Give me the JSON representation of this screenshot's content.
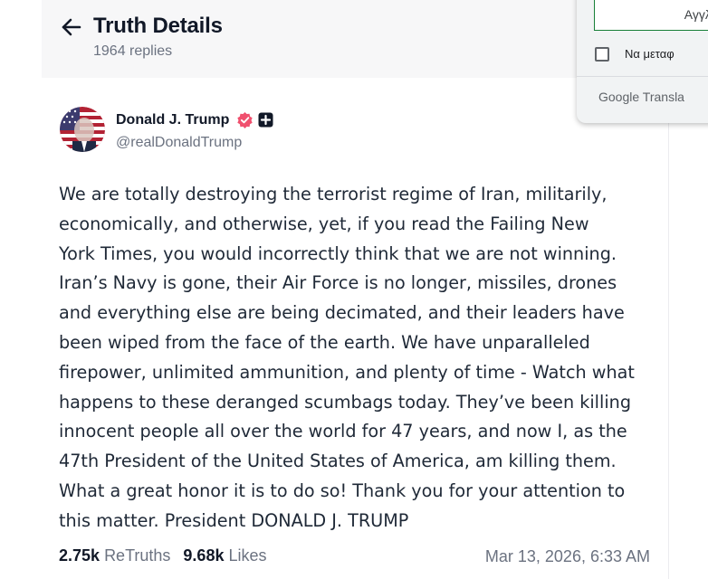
{
  "header": {
    "back_label": "←",
    "title": "Truth Details",
    "replies": "1964 replies"
  },
  "post": {
    "author_name": "Donald J. Trump",
    "handle": "@realDonaldTrump",
    "body_lines": [
      "We are totally destroying the terrorist regime of Iran, militarily,",
      "economically, and otherwise, yet, if you read the Failing New",
      "York Times, you would incorrectly think that we are not winning.",
      "Iran’s Navy is gone, their Air Force is no longer, missiles, drones",
      "and everything else are being decimated, and their leaders have",
      "been wiped from the face of the earth. We have unparalleled",
      "firepower, unlimited ammunition, and plenty of time - Watch what",
      "happens to these deranged scumbags today. They’ve been killing",
      "innocent people all over the world for 47 years, and now I, as the",
      "47th President of the United States of America, am killing them.",
      "What a great honor it is to do so! Thank you for your attention to",
      "this matter. President DONALD J. TRUMP"
    ],
    "retruths_count": "2.75k",
    "retruths_label": "ReTruths",
    "likes_count": "9.68k",
    "likes_label": "Likes",
    "timestamp": "Mar 13, 2026, 6:33 AM"
  },
  "translate_popup": {
    "selected_language": "Αγγλι",
    "checkbox_label": "Να μεταφ",
    "brand_google": "Google",
    "brand_suffix": "Transla"
  },
  "colors": {
    "verified_badge": "#f0506e",
    "text_primary": "#111827",
    "text_secondary": "#6b7280",
    "header_bg": "#f7f7f8",
    "translate_accent": "#188038"
  },
  "icons": {
    "back": "arrow-left-icon",
    "verified": "verified-badge-icon",
    "plus": "plus-badge-icon"
  }
}
